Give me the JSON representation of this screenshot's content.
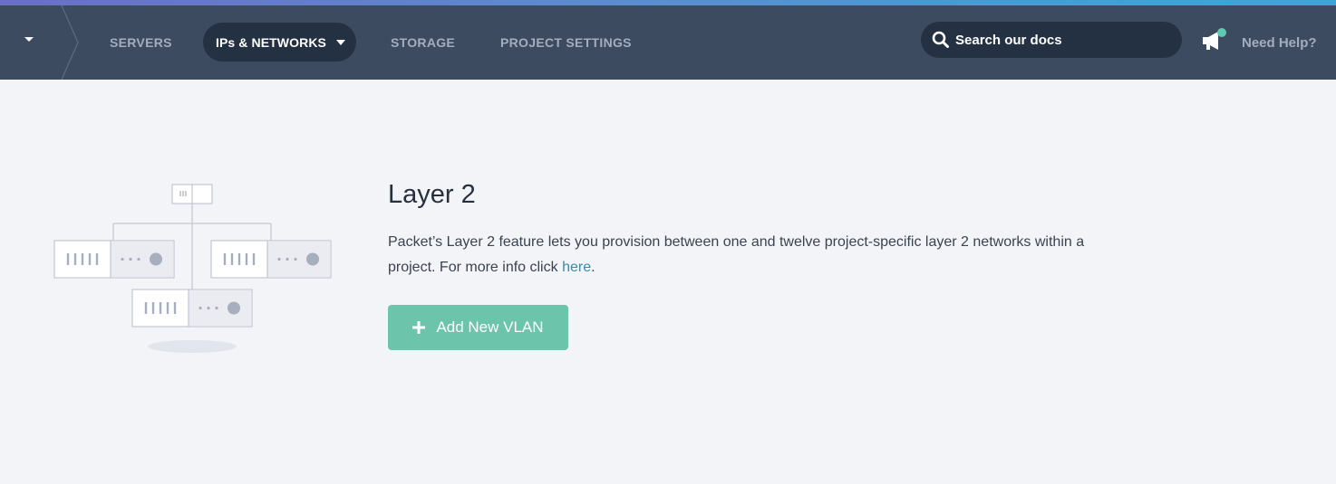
{
  "nav": {
    "context_icon": "caret-down-icon",
    "items": [
      {
        "label": "SERVERS"
      },
      {
        "label": "IPs & NETWORKS",
        "active": true
      },
      {
        "label": "STORAGE"
      },
      {
        "label": "PROJECT SETTINGS"
      }
    ],
    "search": {
      "placeholder": "Search our docs",
      "icon": "search-icon"
    },
    "announcements_icon": "megaphone-icon",
    "help_label": "Need Help?"
  },
  "main": {
    "title": "Layer 2",
    "description_prefix": "Packet’s Layer 2 feature lets you provision between one and twelve project-specific layer 2 networks within a project. For more info click ",
    "link_label": "here",
    "description_suffix": ".",
    "add_button_label": "Add New VLAN",
    "add_button_icon": "plus-icon",
    "illustration": "network-servers-illustration"
  },
  "colors": {
    "nav_bg": "#3d4b60",
    "nav_active_bg": "#243143",
    "page_bg": "#f3f4f8",
    "primary_button": "#6cc5aa",
    "link": "#2d8fb3",
    "notification_dot": "#5fc9b0"
  }
}
